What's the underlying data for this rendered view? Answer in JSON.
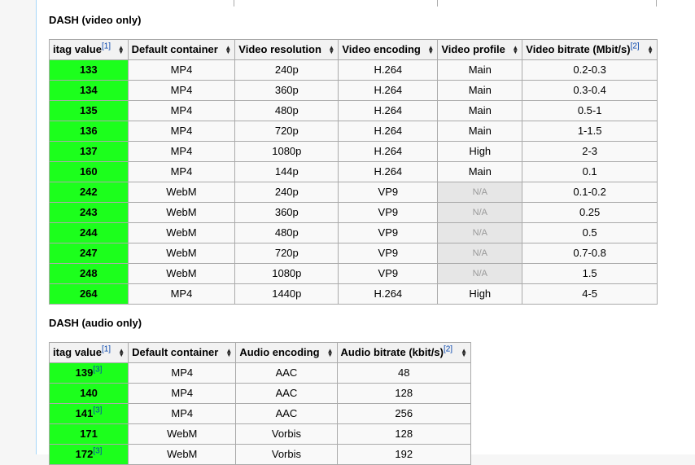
{
  "video_section": {
    "heading": "DASH (video only)",
    "headers": [
      {
        "label": "itag value",
        "ref": "[1]"
      },
      {
        "label": "Default container",
        "ref": ""
      },
      {
        "label": "Video resolution",
        "ref": ""
      },
      {
        "label": "Video encoding",
        "ref": ""
      },
      {
        "label": "Video profile",
        "ref": ""
      },
      {
        "label": "Video bitrate (Mbit/s)",
        "ref": "[2]"
      }
    ],
    "rows": [
      {
        "itag": "133",
        "ref": "",
        "container": "MP4",
        "resolution": "240p",
        "encoding": "H.264",
        "profile": "Main",
        "bitrate": "0.2-0.3"
      },
      {
        "itag": "134",
        "ref": "",
        "container": "MP4",
        "resolution": "360p",
        "encoding": "H.264",
        "profile": "Main",
        "bitrate": "0.3-0.4"
      },
      {
        "itag": "135",
        "ref": "",
        "container": "MP4",
        "resolution": "480p",
        "encoding": "H.264",
        "profile": "Main",
        "bitrate": "0.5-1"
      },
      {
        "itag": "136",
        "ref": "",
        "container": "MP4",
        "resolution": "720p",
        "encoding": "H.264",
        "profile": "Main",
        "bitrate": "1-1.5"
      },
      {
        "itag": "137",
        "ref": "",
        "container": "MP4",
        "resolution": "1080p",
        "encoding": "H.264",
        "profile": "High",
        "bitrate": "2-3"
      },
      {
        "itag": "160",
        "ref": "",
        "container": "MP4",
        "resolution": "144p",
        "encoding": "H.264",
        "profile": "Main",
        "bitrate": "0.1"
      },
      {
        "itag": "242",
        "ref": "",
        "container": "WebM",
        "resolution": "240p",
        "encoding": "VP9",
        "profile": "N/A",
        "bitrate": "0.1-0.2"
      },
      {
        "itag": "243",
        "ref": "",
        "container": "WebM",
        "resolution": "360p",
        "encoding": "VP9",
        "profile": "N/A",
        "bitrate": "0.25"
      },
      {
        "itag": "244",
        "ref": "",
        "container": "WebM",
        "resolution": "480p",
        "encoding": "VP9",
        "profile": "N/A",
        "bitrate": "0.5"
      },
      {
        "itag": "247",
        "ref": "",
        "container": "WebM",
        "resolution": "720p",
        "encoding": "VP9",
        "profile": "N/A",
        "bitrate": "0.7-0.8"
      },
      {
        "itag": "248",
        "ref": "",
        "container": "WebM",
        "resolution": "1080p",
        "encoding": "VP9",
        "profile": "N/A",
        "bitrate": "1.5"
      },
      {
        "itag": "264",
        "ref": "",
        "container": "MP4",
        "resolution": "1440p",
        "encoding": "H.264",
        "profile": "High",
        "bitrate": "4-5"
      }
    ]
  },
  "audio_section": {
    "heading": "DASH (audio only)",
    "headers": [
      {
        "label": "itag value",
        "ref": "[1]"
      },
      {
        "label": "Default container",
        "ref": ""
      },
      {
        "label": "Audio encoding",
        "ref": ""
      },
      {
        "label": "Audio bitrate (kbit/s)",
        "ref": "[2]"
      }
    ],
    "rows": [
      {
        "itag": "139",
        "ref": "[3]",
        "container": "MP4",
        "encoding": "AAC",
        "bitrate": "48"
      },
      {
        "itag": "140",
        "ref": "",
        "container": "MP4",
        "encoding": "AAC",
        "bitrate": "128"
      },
      {
        "itag": "141",
        "ref": "[3]",
        "container": "MP4",
        "encoding": "AAC",
        "bitrate": "256"
      },
      {
        "itag": "171",
        "ref": "",
        "container": "WebM",
        "encoding": "Vorbis",
        "bitrate": "128"
      },
      {
        "itag": "172",
        "ref": "[3]",
        "container": "WebM",
        "encoding": "Vorbis",
        "bitrate": "192"
      }
    ]
  },
  "sort_icon": "sort-arrows-icon",
  "colors": {
    "itag_cell": "#1cff1c",
    "na_cell": "#e6e6e6",
    "header_bg": "#f2f2f2",
    "ref_link": "#0645ad"
  }
}
